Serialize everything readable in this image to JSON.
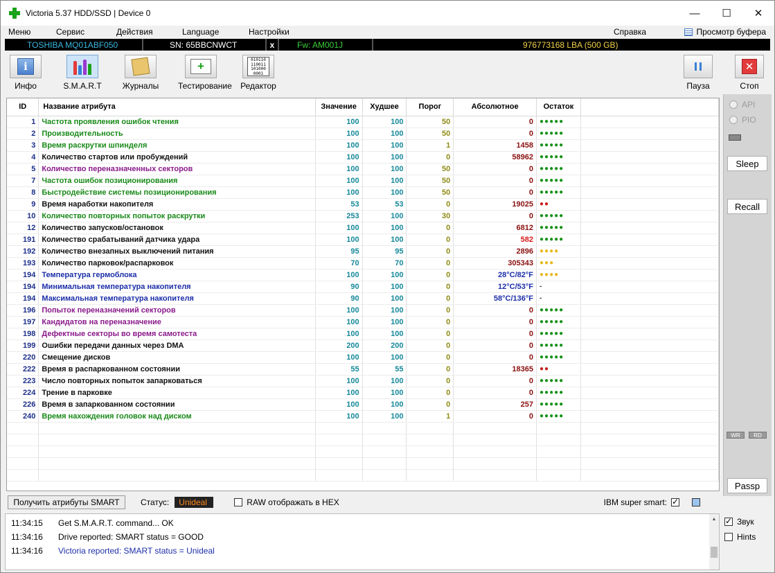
{
  "window": {
    "title": "Victoria 5.37 HDD/SSD | Device 0",
    "minimize": "—",
    "maximize": "☐",
    "close": "✕"
  },
  "menu": {
    "items": [
      "Меню",
      "Сервис",
      "Действия",
      "Language",
      "Настройки"
    ],
    "help": "Справка",
    "buffer": "Просмотр буфера"
  },
  "device": {
    "model": "TOSHIBA MQ01ABF050",
    "serial": "SN: 65BBCNWCT",
    "close": "x",
    "firmware": "Fw: AM001J",
    "lba": "976773168 LBA (500 GB)"
  },
  "toolbar": {
    "info": "Инфо",
    "smart": "S.M.A.R.T",
    "journals": "Журналы",
    "testing": "Тестирование",
    "editor": "Редактор",
    "pause": "Пауза",
    "stop": "Стоп",
    "info_icon": "i",
    "test_icon": "+",
    "stop_icon": "✕",
    "editor_icon": [
      "010110",
      "110011",
      "101000",
      "0001"
    ]
  },
  "table": {
    "headers": {
      "id": "ID",
      "name": "Название атрибута",
      "value": "Значение",
      "worst": "Худшее",
      "threshold": "Порог",
      "raw": "Абсолютное",
      "health": "Остаток"
    },
    "rows": [
      {
        "id": "1",
        "name": "Частота проявления ошибок чтения",
        "nc": "green",
        "value": "100",
        "worst": "100",
        "thr": "50",
        "raw": "0",
        "rc": "",
        "health": "●●●●●",
        "hc": "green"
      },
      {
        "id": "2",
        "name": "Производительность",
        "nc": "green",
        "value": "100",
        "worst": "100",
        "thr": "50",
        "raw": "0",
        "rc": "",
        "health": "●●●●●",
        "hc": "green"
      },
      {
        "id": "3",
        "name": "Время раскрутки шпинделя",
        "nc": "green",
        "value": "100",
        "worst": "100",
        "thr": "1",
        "raw": "1458",
        "rc": "",
        "health": "●●●●●",
        "hc": "green"
      },
      {
        "id": "4",
        "name": "Количество стартов или пробуждений",
        "nc": "black",
        "value": "100",
        "worst": "100",
        "thr": "0",
        "raw": "58962",
        "rc": "",
        "health": "●●●●●",
        "hc": "green"
      },
      {
        "id": "5",
        "name": "Количество переназначенных секторов",
        "nc": "purple",
        "value": "100",
        "worst": "100",
        "thr": "50",
        "raw": "0",
        "rc": "",
        "health": "●●●●●",
        "hc": "green"
      },
      {
        "id": "7",
        "name": "Частота ошибок позиционирования",
        "nc": "green",
        "value": "100",
        "worst": "100",
        "thr": "50",
        "raw": "0",
        "rc": "",
        "health": "●●●●●",
        "hc": "green"
      },
      {
        "id": "8",
        "name": "Быстродействие системы позиционирования",
        "nc": "green",
        "value": "100",
        "worst": "100",
        "thr": "50",
        "raw": "0",
        "rc": "",
        "health": "●●●●●",
        "hc": "green"
      },
      {
        "id": "9",
        "name": "Время наработки накопителя",
        "nc": "black",
        "value": "53",
        "worst": "53",
        "thr": "0",
        "raw": "19025",
        "rc": "",
        "health": "●●",
        "hc": "red"
      },
      {
        "id": "10",
        "name": "Количество повторных попыток раскрутки",
        "nc": "green",
        "value": "253",
        "worst": "100",
        "thr": "30",
        "raw": "0",
        "rc": "",
        "health": "●●●●●",
        "hc": "green"
      },
      {
        "id": "12",
        "name": "Количество запусков/остановок",
        "nc": "black",
        "value": "100",
        "worst": "100",
        "thr": "0",
        "raw": "6812",
        "rc": "",
        "health": "●●●●●",
        "hc": "green"
      },
      {
        "id": "191",
        "name": "Количество срабатываний датчика удара",
        "nc": "black",
        "value": "100",
        "worst": "100",
        "thr": "0",
        "raw": "582",
        "rc": "red",
        "health": "●●●●●",
        "hc": "green"
      },
      {
        "id": "192",
        "name": "Количество внезапных выключений питания",
        "nc": "black",
        "value": "95",
        "worst": "95",
        "thr": "0",
        "raw": "2896",
        "rc": "",
        "health": "●●●●",
        "hc": "yellow"
      },
      {
        "id": "193",
        "name": "Количество парковок/распарковок",
        "nc": "black",
        "value": "70",
        "worst": "70",
        "thr": "0",
        "raw": "305343",
        "rc": "",
        "health": "●●●",
        "hc": "yellow"
      },
      {
        "id": "194",
        "name": "Температура гермоблока",
        "nc": "blue",
        "value": "100",
        "worst": "100",
        "thr": "0",
        "raw": "28°C/82°F",
        "rc": "blue",
        "health": "●●●●",
        "hc": "yellow"
      },
      {
        "id": "194",
        "name": "Минимальная температура накопителя",
        "nc": "blue",
        "value": "90",
        "worst": "100",
        "thr": "0",
        "raw": "12°C/53°F",
        "rc": "blue",
        "health": "-",
        "hc": "black"
      },
      {
        "id": "194",
        "name": "Максимальная температура накопителя",
        "nc": "blue",
        "value": "90",
        "worst": "100",
        "thr": "0",
        "raw": "58°C/136°F",
        "rc": "blue",
        "health": "-",
        "hc": "black"
      },
      {
        "id": "196",
        "name": "Попыток переназначений секторов",
        "nc": "purple",
        "value": "100",
        "worst": "100",
        "thr": "0",
        "raw": "0",
        "rc": "",
        "health": "●●●●●",
        "hc": "green"
      },
      {
        "id": "197",
        "name": "Кандидатов на переназначение",
        "nc": "purple",
        "value": "100",
        "worst": "100",
        "thr": "0",
        "raw": "0",
        "rc": "",
        "health": "●●●●●",
        "hc": "green"
      },
      {
        "id": "198",
        "name": "Дефектные секторы во время самотеста",
        "nc": "purple",
        "value": "100",
        "worst": "100",
        "thr": "0",
        "raw": "0",
        "rc": "",
        "health": "●●●●●",
        "hc": "green"
      },
      {
        "id": "199",
        "name": "Ошибки передачи данных через DMA",
        "nc": "black",
        "value": "200",
        "worst": "200",
        "thr": "0",
        "raw": "0",
        "rc": "",
        "health": "●●●●●",
        "hc": "green"
      },
      {
        "id": "220",
        "name": "Смещение дисков",
        "nc": "black",
        "value": "100",
        "worst": "100",
        "thr": "0",
        "raw": "0",
        "rc": "",
        "health": "●●●●●",
        "hc": "green"
      },
      {
        "id": "222",
        "name": "Время в распаркованном состоянии",
        "nc": "black",
        "value": "55",
        "worst": "55",
        "thr": "0",
        "raw": "18365",
        "rc": "",
        "health": "●●",
        "hc": "red"
      },
      {
        "id": "223",
        "name": "Число повторных попыток запарковаться",
        "nc": "black",
        "value": "100",
        "worst": "100",
        "thr": "0",
        "raw": "0",
        "rc": "",
        "health": "●●●●●",
        "hc": "green"
      },
      {
        "id": "224",
        "name": "Трение в парковке",
        "nc": "black",
        "value": "100",
        "worst": "100",
        "thr": "0",
        "raw": "0",
        "rc": "",
        "health": "●●●●●",
        "hc": "green"
      },
      {
        "id": "226",
        "name": "Время в запаркованном состоянии",
        "nc": "black",
        "value": "100",
        "worst": "100",
        "thr": "0",
        "raw": "257",
        "rc": "",
        "health": "●●●●●",
        "hc": "green"
      },
      {
        "id": "240",
        "name": "Время нахождения головок над диском",
        "nc": "green",
        "value": "100",
        "worst": "100",
        "thr": "1",
        "raw": "0",
        "rc": "",
        "health": "●●●●●",
        "hc": "green"
      }
    ]
  },
  "side": {
    "api": "API",
    "pio": "PIO",
    "sleep": "Sleep",
    "recall": "Recall",
    "wr": "WR",
    "rd": "RD",
    "passp": "Passp"
  },
  "status": {
    "get_button": "Получить атрибуты SMART",
    "label": "Статус:",
    "value": "Unideal",
    "raw_hex": "RAW отображать в HEX",
    "ibm": "IBM super smart:"
  },
  "log": [
    {
      "time": "11:34:15",
      "msg": "Get S.M.A.R.T. command... OK",
      "blue": false
    },
    {
      "time": "11:34:16",
      "msg": "Drive reported: SMART status = GOOD",
      "blue": false
    },
    {
      "time": "11:34:16",
      "msg": "Victoria reported: SMART status = Unideal",
      "blue": true
    }
  ],
  "options": {
    "sound": "Звук",
    "hints": "Hints"
  }
}
